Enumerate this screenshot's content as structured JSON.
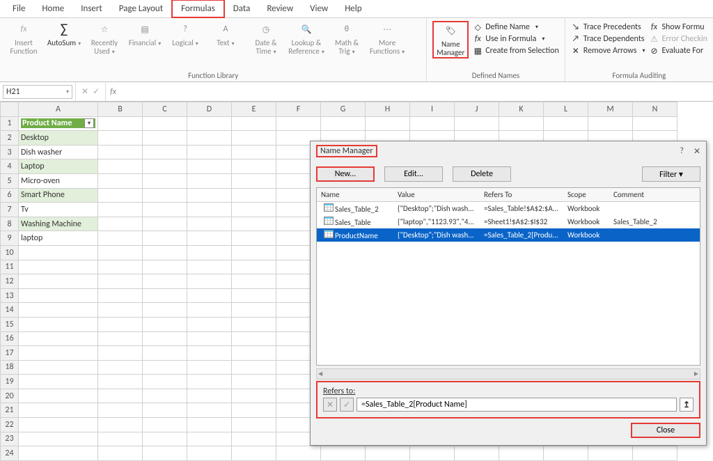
{
  "tabs": [
    "File",
    "Home",
    "Insert",
    "Page Layout",
    "Formulas",
    "Data",
    "Review",
    "View",
    "Help"
  ],
  "active_tab": 4,
  "ribbon": {
    "insert_function": "Insert\nFunction",
    "autosum": "AutoSum",
    "recent": "Recently\nUsed",
    "financial": "Financial",
    "logical": "Logical",
    "text": "Text",
    "date": "Date &\nTime",
    "lookup": "Lookup &\nReference",
    "math": "Math &\nTrig",
    "more": "More\nFunctions",
    "name_mgr": "Name\nManager",
    "define_name": "Define Name",
    "use_in_formula": "Use in Formula",
    "create_sel": "Create from Selection",
    "trace_prec": "Trace Precedents",
    "trace_dep": "Trace Dependents",
    "remove_arrows": "Remove Arrows",
    "show_form": "Show Formu",
    "err_check": "Error Checkin",
    "eval_form": "Evaluate For",
    "grp_func": "Function Library",
    "grp_names": "Defined Names",
    "grp_audit": "Formula Auditing"
  },
  "fb": {
    "namebox": "H21"
  },
  "columns": [
    "",
    "A",
    "B",
    "C",
    "D",
    "E",
    "F",
    "G",
    "H",
    "I",
    "J",
    "K",
    "L",
    "M",
    "N"
  ],
  "rows": [
    1,
    2,
    3,
    4,
    5,
    6,
    7,
    8,
    9,
    10,
    11,
    12,
    13,
    14,
    15,
    16,
    17,
    18,
    19,
    20,
    21,
    22,
    23,
    24
  ],
  "colA": {
    "header": "Product Name",
    "vals": [
      "Desktop",
      "Dish washer",
      "Laptop",
      "Micro-oven",
      "Smart Phone",
      "Tv",
      "Washing Machine",
      "laptop"
    ]
  },
  "dialog": {
    "title": "Name Manager",
    "new": "New...",
    "edit": "Edit...",
    "delete": "Delete",
    "filter": "Filter",
    "headers": [
      "Name",
      "Value",
      "Refers To",
      "Scope",
      "Comment"
    ],
    "rows": [
      {
        "name": "Sales_Table_2",
        "value": "{\"Desktop\";\"Dish wash...",
        "refers": "=Sales_Table!$A$2:$A...",
        "scope": "Workbook",
        "comment": ""
      },
      {
        "name": "Sales_Table",
        "value": "{\"laptop\",\"1123.93\",\"4...",
        "refers": "=Sheet1!$A$2:$I$32",
        "scope": "Workbook",
        "comment": "Sales_Table_2"
      },
      {
        "name": "ProductName",
        "value": "{\"Desktop\";\"Dish wash...",
        "refers": "=Sales_Table_2[Produ...",
        "scope": "Workbook",
        "comment": ""
      }
    ],
    "selected": 2,
    "refers_label": "Refers to:",
    "refers_value": "=Sales_Table_2[Product Name]",
    "close": "Close"
  }
}
